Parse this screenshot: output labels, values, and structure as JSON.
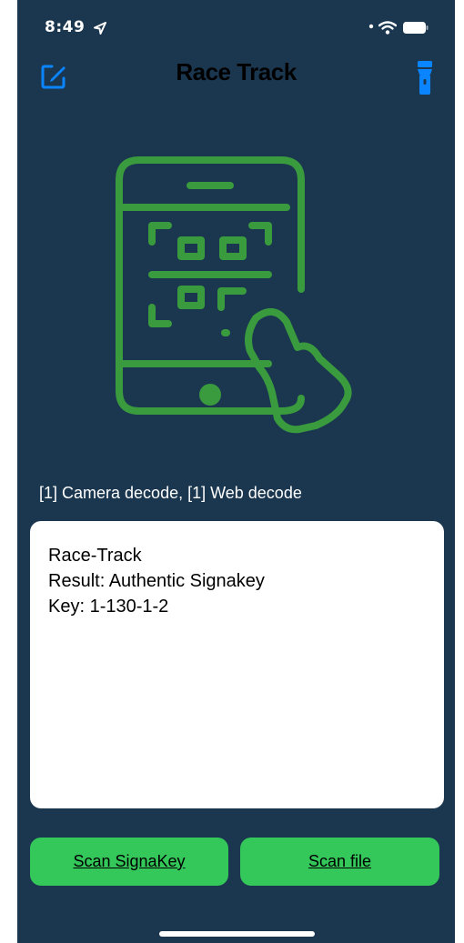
{
  "status_bar": {
    "time": "8:49",
    "icons": [
      "location-arrow-icon",
      "signal-icon",
      "wifi-icon",
      "battery-icon"
    ]
  },
  "nav": {
    "title": "Race Track",
    "left_icon": "compose-icon",
    "right_icon": "flashlight-icon"
  },
  "hero": {
    "icon": "phone-qr-scan-icon"
  },
  "decode_status": "[1] Camera decode, [1] Web decode",
  "result": {
    "lines": [
      "Race-Track",
      "Result: Authentic Signakey",
      "Key: 1-130-1-2"
    ]
  },
  "actions": {
    "scan_signakey_label": "Scan SignaKey",
    "scan_file_label": "Scan file"
  },
  "colors": {
    "background": "#1b374f",
    "accent_blue": "#0a84ff",
    "icon_green": "#3a9a3e",
    "button_green": "#34c759"
  }
}
